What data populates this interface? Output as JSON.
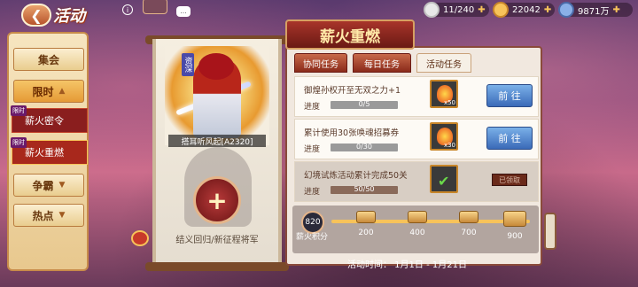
{
  "header": {
    "back_icon": "back-arrow-icon",
    "title": "活动",
    "chat_glyph": "…",
    "resources": [
      {
        "name": "stamina",
        "value": "11/240",
        "color": "#e8e8e8"
      },
      {
        "name": "gold",
        "value": "22042",
        "color": "#f7c35a"
      },
      {
        "name": "silver",
        "value": "9871万",
        "color": "#8ab0e8"
      }
    ]
  },
  "sidebar": {
    "items": [
      {
        "label": "集会"
      },
      {
        "label": "限时"
      },
      {
        "label": "争霸"
      },
      {
        "label": "热点"
      }
    ],
    "sub_items": [
      {
        "tag": "限时",
        "label": "薪火密令"
      },
      {
        "tag": "限时",
        "label": "薪火重燃"
      }
    ]
  },
  "hero": {
    "badge": "资深",
    "name": "搭耳听风起[A2320]",
    "add_glyph": "+",
    "recall_text": "结义回归/新征程将军"
  },
  "panel": {
    "title": "薪火重燃",
    "tabs": [
      "协同任务",
      "每日任务",
      "活动任务"
    ],
    "progress_label": "进度",
    "tasks": [
      {
        "title": "御煌孙权开至无双之力+1",
        "progress": "0/5",
        "reward_count": "x50",
        "button": "前 往",
        "done": false
      },
      {
        "title": "累计使用30张唤魂招募券",
        "progress": "0/30",
        "reward_count": "x30",
        "button": "前 往",
        "done": false
      },
      {
        "title": "幻境试炼活动累计完成50关",
        "progress": "50/50",
        "reward_count": "",
        "button": "已领取",
        "done": true
      }
    ],
    "fire_value": "820",
    "fire_label": "薪火积分",
    "milestones": [
      "200",
      "400",
      "700",
      "900"
    ],
    "activity_time": "活动时间： 1月1日 - 1月21日"
  }
}
